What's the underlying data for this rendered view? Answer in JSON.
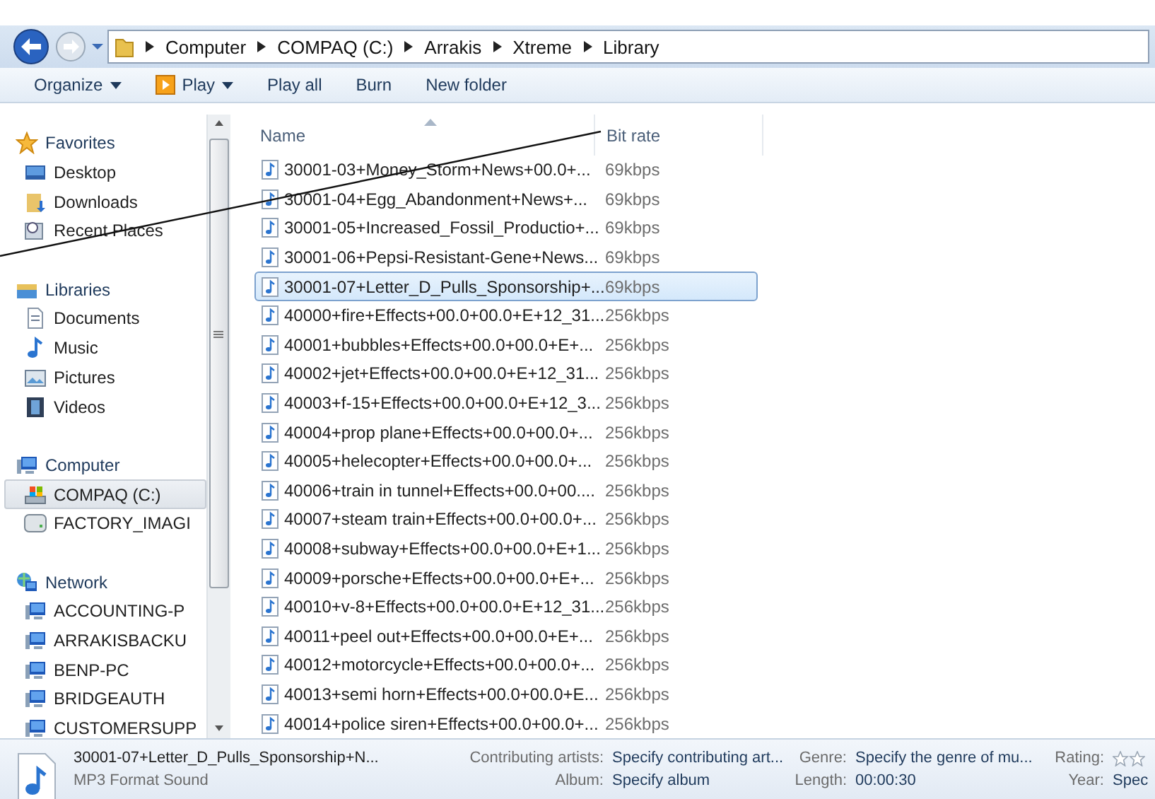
{
  "address": {
    "crumbs": [
      "Computer",
      "COMPAQ (C:)",
      "Arrakis",
      "Xtreme",
      "Library"
    ]
  },
  "toolbar": [
    {
      "label": "Organize",
      "kind": "menu"
    },
    {
      "label": "Play",
      "kind": "play-menu"
    },
    {
      "label": "Play all",
      "kind": "button"
    },
    {
      "label": "Burn",
      "kind": "button"
    },
    {
      "label": "New folder",
      "kind": "button"
    }
  ],
  "nav": [
    {
      "label": "Favorites",
      "kind": "star",
      "selected": false,
      "children": [
        {
          "label": "Desktop",
          "kind": "desktop",
          "selected": false
        },
        {
          "label": "Downloads",
          "kind": "downloads",
          "selected": false
        },
        {
          "label": "Recent Places",
          "kind": "recent",
          "selected": false
        }
      ]
    },
    {
      "label": "Libraries",
      "kind": "library",
      "selected": false,
      "children": [
        {
          "label": "Documents",
          "kind": "documents",
          "selected": false
        },
        {
          "label": "Music",
          "kind": "music",
          "selected": false
        },
        {
          "label": "Pictures",
          "kind": "pictures",
          "selected": false
        },
        {
          "label": "Videos",
          "kind": "videos",
          "selected": false
        }
      ]
    },
    {
      "label": "Computer",
      "kind": "computer",
      "selected": false,
      "children": [
        {
          "label": "COMPAQ (C:)",
          "kind": "system-drive",
          "selected": true
        },
        {
          "label": "FACTORY_IMAGI",
          "kind": "drive",
          "selected": false
        }
      ]
    },
    {
      "label": "Network",
      "kind": "network",
      "selected": false,
      "children": [
        {
          "label": "ACCOUNTING-P",
          "kind": "computer",
          "selected": false
        },
        {
          "label": "ARRAKISBACKU",
          "kind": "computer",
          "selected": false
        },
        {
          "label": "BENP-PC",
          "kind": "computer",
          "selected": false
        },
        {
          "label": "BRIDGEAUTH",
          "kind": "computer",
          "selected": false
        },
        {
          "label": "CUSTOMERSUPP",
          "kind": "computer",
          "selected": false
        }
      ]
    }
  ],
  "table": {
    "columns": [
      {
        "label": "Name",
        "sorted": true
      },
      {
        "label": "Bit rate",
        "sorted": false
      }
    ],
    "rows": [
      {
        "name": "30001-03+Money_Storm+News+00.0+...",
        "bit_rate": "69kbps",
        "selected": false
      },
      {
        "name": "30001-04+Egg_Abandonment+News+...",
        "bit_rate": "69kbps",
        "selected": false
      },
      {
        "name": "30001-05+Increased_Fossil_Productio+...",
        "bit_rate": "69kbps",
        "selected": false
      },
      {
        "name": "30001-06+Pepsi-Resistant-Gene+News...",
        "bit_rate": "69kbps",
        "selected": false
      },
      {
        "name": "30001-07+Letter_D_Pulls_Sponsorship+...",
        "bit_rate": "69kbps",
        "selected": true
      },
      {
        "name": "40000+fire+Effects+00.0+00.0+E+12_31...",
        "bit_rate": "256kbps",
        "selected": false
      },
      {
        "name": "40001+bubbles+Effects+00.0+00.0+E+...",
        "bit_rate": "256kbps",
        "selected": false
      },
      {
        "name": "40002+jet+Effects+00.0+00.0+E+12_31...",
        "bit_rate": "256kbps",
        "selected": false
      },
      {
        "name": "40003+f-15+Effects+00.0+00.0+E+12_3...",
        "bit_rate": "256kbps",
        "selected": false
      },
      {
        "name": "40004+prop plane+Effects+00.0+00.0+...",
        "bit_rate": "256kbps",
        "selected": false
      },
      {
        "name": "40005+helecopter+Effects+00.0+00.0+...",
        "bit_rate": "256kbps",
        "selected": false
      },
      {
        "name": "40006+train in tunnel+Effects+00.0+00....",
        "bit_rate": "256kbps",
        "selected": false
      },
      {
        "name": "40007+steam train+Effects+00.0+00.0+...",
        "bit_rate": "256kbps",
        "selected": false
      },
      {
        "name": "40008+subway+Effects+00.0+00.0+E+1...",
        "bit_rate": "256kbps",
        "selected": false
      },
      {
        "name": "40009+porsche+Effects+00.0+00.0+E+...",
        "bit_rate": "256kbps",
        "selected": false
      },
      {
        "name": "40010+v-8+Effects+00.0+00.0+E+12_31...",
        "bit_rate": "256kbps",
        "selected": false
      },
      {
        "name": "40011+peel out+Effects+00.0+00.0+E+...",
        "bit_rate": "256kbps",
        "selected": false
      },
      {
        "name": "40012+motorcycle+Effects+00.0+00.0+...",
        "bit_rate": "256kbps",
        "selected": false
      },
      {
        "name": "40013+semi horn+Effects+00.0+00.0+E...",
        "bit_rate": "256kbps",
        "selected": false
      },
      {
        "name": "40014+police siren+Effects+00.0+00.0+...",
        "bit_rate": "256kbps",
        "selected": false
      }
    ]
  },
  "details": {
    "title": "30001-07+Letter_D_Pulls_Sponsorship+N...",
    "type": "MP3 Format Sound",
    "properties": [
      {
        "label": "Contributing artists:",
        "value": "Specify contributing art..."
      },
      {
        "label": "Genre:",
        "value": "Specify the genre of mu..."
      },
      {
        "label": "Rating:",
        "kind": "rating"
      },
      {
        "label": "Album:",
        "value": "Specify album"
      },
      {
        "label": "Length:",
        "value": "00:00:30"
      },
      {
        "label": "Year:",
        "value": "Spec"
      }
    ]
  },
  "annotation": {
    "kind": "line"
  }
}
